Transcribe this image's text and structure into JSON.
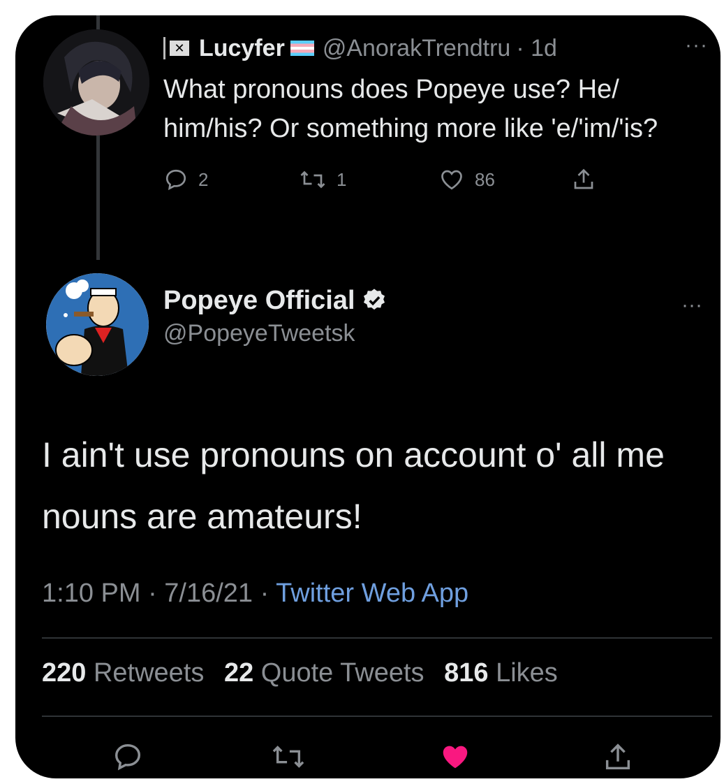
{
  "reply_tweet": {
    "display_name": "Lucyfer",
    "handle": "@AnorakTrendtru",
    "time": "· 1d",
    "more": "···",
    "text": "What pronouns does Popeye use? He/ him/his? Or something more like 'e/'im/'is?",
    "replies": "2",
    "retweets": "1",
    "likes": "86"
  },
  "main_tweet": {
    "display_name": "Popeye Official",
    "handle": "@PopeyeTweetsk",
    "more": "···",
    "text": "I ain't use pronouns on account o' all me nouns are amateurs!",
    "time": "1:10 PM · 7/16/21 ·",
    "source": "Twitter Web App",
    "stats": {
      "retweets_count": "220",
      "retweets_label": "Retweets",
      "quotes_count": "22",
      "quotes_label": "Quote Tweets",
      "likes_count": "816",
      "likes_label": "Likes"
    }
  },
  "icons": {
    "reply": "reply-icon",
    "retweet": "retweet-icon",
    "like": "heart-icon",
    "share": "share-icon",
    "verified": "verified-badge-icon"
  },
  "colors": {
    "background": "#000000",
    "text": "#e7e9ea",
    "muted": "#8b8f94",
    "link": "#6f9fdf",
    "liked": "#f91880"
  }
}
